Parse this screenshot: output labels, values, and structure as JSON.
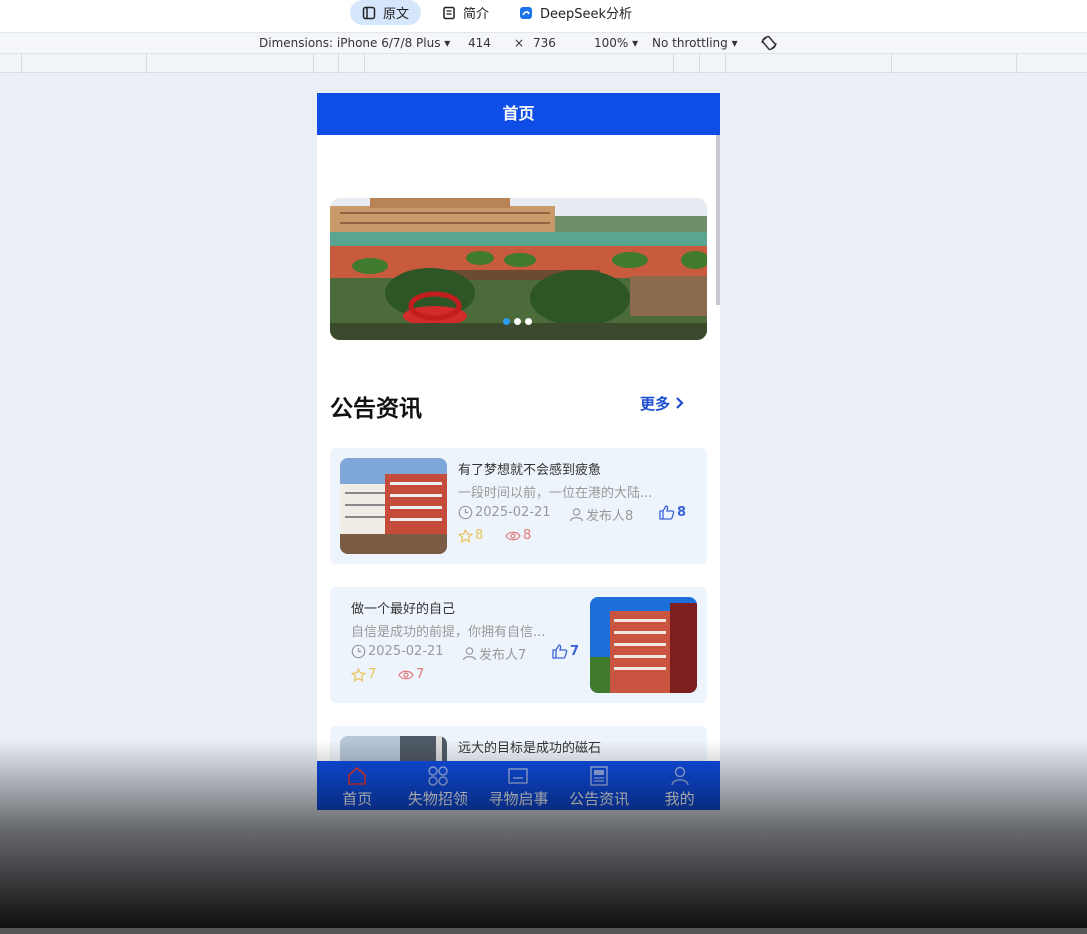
{
  "reader_tabs": [
    {
      "label": "原文",
      "icon": "document-icon",
      "active": true
    },
    {
      "label": "简介",
      "icon": "notes-icon",
      "active": false
    },
    {
      "label": "DeepSeek分析",
      "icon": "deepseek-icon",
      "active": false
    }
  ],
  "devtools": {
    "dimensions": "Dimensions: iPhone 6/7/8 Plus",
    "width": "414",
    "times": "×",
    "height": "736",
    "zoom": "100%",
    "throttling": "No throttling"
  },
  "app": {
    "page_title": "首页",
    "banner_dot_count": 3,
    "section_title": "公告资讯",
    "more_label": "更多",
    "news": [
      {
        "title": "有了梦想就不会感到疲惫",
        "desc": "一段时间以前，一位在港的大陆...",
        "date": "2025-02-21",
        "author": "发布人8",
        "likes": "8",
        "stars": "8",
        "views": "8"
      },
      {
        "title": "做一个最好的自己",
        "desc": "自信是成功的前提，你拥有自信...",
        "date": "2025-02-21",
        "author": "发布人7",
        "likes": "7",
        "stars": "7",
        "views": "7"
      },
      {
        "title": "远大的目标是成功的磁石"
      }
    ],
    "tabbar": [
      {
        "label": "首页",
        "icon": "home-icon"
      },
      {
        "label": "失物招领",
        "icon": "grid-icon"
      },
      {
        "label": "寻物启事",
        "icon": "notice-board-icon"
      },
      {
        "label": "公告资讯",
        "icon": "newspaper-icon"
      },
      {
        "label": "我的",
        "icon": "user-icon"
      }
    ]
  },
  "colors": {
    "primary": "#0f4ee6",
    "accent_blue": "#1d4fd0",
    "star": "#e8c45a",
    "view": "#e27a7a"
  }
}
